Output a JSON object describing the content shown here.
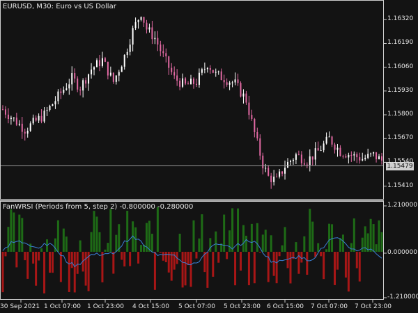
{
  "window": {
    "symbol_line": "EURUSD, M30:  Euro vs US Dollar"
  },
  "indicator": {
    "title": "FanWRSI (Periods from 5, step 2) -0.800000 -0.280000",
    "axis_labels": [
      "1.210000",
      "0.000000",
      "-1.210000"
    ]
  },
  "current_price": "1.15479",
  "colors": {
    "background": "#131313",
    "bull_body": "#ffffff",
    "bear_body": "#e36aa4",
    "positive_bar": "#1e6b16",
    "negative_bar": "#a81616",
    "signal_line": "#3a7fd5",
    "axis": "#cfcfcf"
  },
  "chart_data": {
    "type": "line",
    "price_axis": {
      "ticks": [
        "1.16320",
        "1.16190",
        "1.16060",
        "1.15930",
        "1.15800",
        "1.15670",
        "1.15540",
        "1.15410"
      ],
      "ylim": [
        1.1534,
        1.1642
      ]
    },
    "time_axis": {
      "ticks": [
        "30 Sep 2021",
        "1 Oct 07:00",
        "1 Oct 23:00",
        "4 Oct 15:00",
        "5 Oct 07:00",
        "5 Oct 23:00",
        "6 Oct 15:00",
        "7 Oct 07:00",
        "7 Oct 23:00"
      ]
    },
    "price_path": [
      [
        0,
        1.1583
      ],
      [
        8,
        1.1572
      ],
      [
        15,
        1.158
      ],
      [
        20,
        1.159
      ],
      [
        25,
        1.16
      ],
      [
        28,
        1.1595
      ],
      [
        32,
        1.1605
      ],
      [
        36,
        1.161
      ],
      [
        40,
        1.1598
      ],
      [
        44,
        1.1612
      ],
      [
        47,
        1.1626
      ],
      [
        50,
        1.1636
      ],
      [
        52,
        1.1627
      ],
      [
        55,
        1.1622
      ],
      [
        58,
        1.1612
      ],
      [
        62,
        1.16
      ],
      [
        66,
        1.1596
      ],
      [
        70,
        1.1598
      ],
      [
        74,
        1.1608
      ],
      [
        77,
        1.1602
      ],
      [
        80,
        1.16
      ],
      [
        84,
        1.1597
      ],
      [
        88,
        1.1588
      ],
      [
        91,
        1.157
      ],
      [
        94,
        1.1553
      ],
      [
        96,
        1.1546
      ],
      [
        99,
        1.1544
      ],
      [
        102,
        1.1552
      ],
      [
        106,
        1.1558
      ],
      [
        110,
        1.1555
      ],
      [
        114,
        1.156
      ],
      [
        118,
        1.1567
      ],
      [
        122,
        1.156
      ],
      [
        126,
        1.1558
      ],
      [
        130,
        1.1556
      ],
      [
        134,
        1.1558
      ],
      [
        138,
        1.1554
      ]
    ],
    "indicator_ylim": [
      -1.21,
      1.21
    ]
  }
}
